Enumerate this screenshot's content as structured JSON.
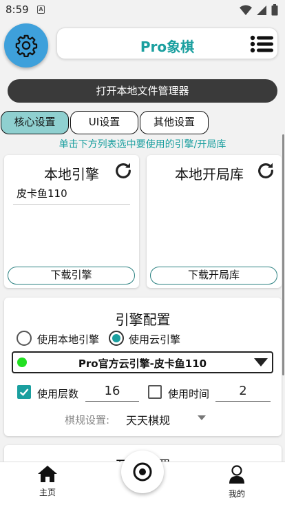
{
  "status": {
    "time": "8:59",
    "notif_icon": "A"
  },
  "header": {
    "title": "Pro象棋"
  },
  "actions": {
    "open_file_manager": "打开本地文件管理器"
  },
  "tabs": [
    {
      "label": "核心设置",
      "active": true
    },
    {
      "label": "UI设置",
      "active": false
    },
    {
      "label": "其他设置",
      "active": false
    }
  ],
  "hint": "单击下方列表选中要使用的引擎/开局库",
  "local_engine": {
    "title": "本地引擎",
    "items": [
      "皮卡鱼110"
    ],
    "download_label": "下载引擎"
  },
  "local_book": {
    "title": "本地开局库",
    "items": [],
    "download_label": "下载开局库"
  },
  "engine_config": {
    "title": "引擎配置",
    "use_local_label": "使用本地引擎",
    "use_cloud_label": "使用云引擎",
    "selected_mode": "cloud",
    "selected_engine": "Pro官方云引擎-皮卡鱼110",
    "depth": {
      "label": "使用层数",
      "checked": true,
      "value": "16"
    },
    "time": {
      "label": "使用时间",
      "checked": false,
      "value": "2"
    },
    "rule": {
      "label": "棋规设置:",
      "value": "天天棋规"
    }
  },
  "next_section_title_partial": "开局配置",
  "nav": {
    "home_label": "主页",
    "mine_label": "我的"
  },
  "colors": {
    "accent": "#1a9f9f",
    "gear_bg": "#3ea0db",
    "tab_active": "#8fd0d0",
    "online_dot": "#22e022"
  }
}
